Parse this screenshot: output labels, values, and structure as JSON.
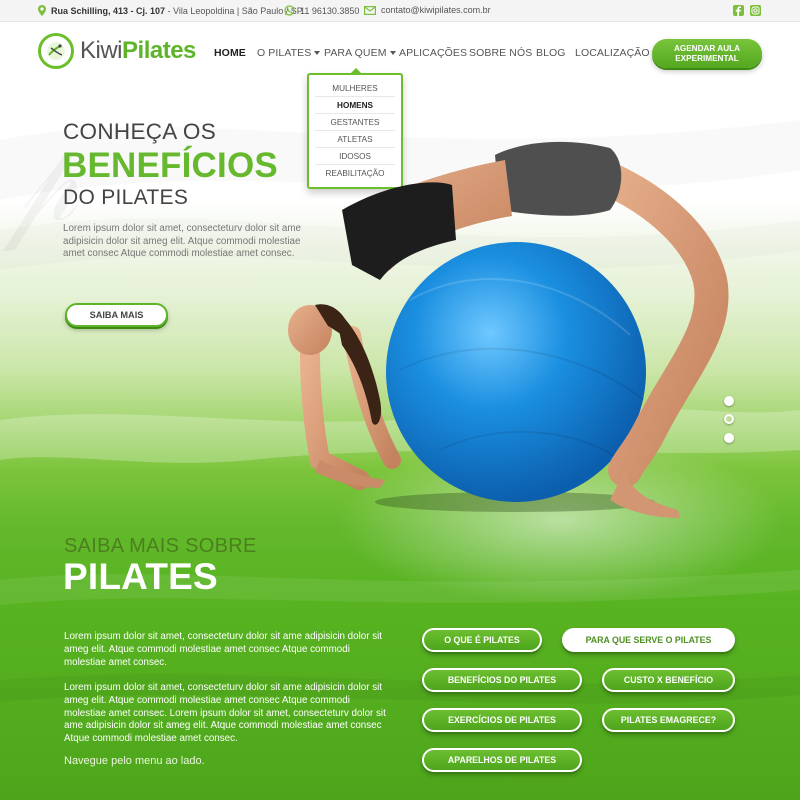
{
  "topbar": {
    "address_bold": "Rua Schilling, 413 - Cj. 107",
    "address_rest": " - Vila Leopoldina | São Paulo / SP",
    "phone": "11 96130.3850",
    "email": "contato@kiwipilates.com.br",
    "social": [
      "facebook-icon",
      "instagram-icon"
    ]
  },
  "logo": {
    "part1": "Kiwi",
    "part2": "Pilates"
  },
  "nav": {
    "items": [
      {
        "label": "HOME",
        "active": true
      },
      {
        "label": "O PILATES",
        "dropdown": true
      },
      {
        "label": "PARA QUEM",
        "dropdown": true,
        "open": true
      },
      {
        "label": "APLICAÇÕES"
      },
      {
        "label": "SOBRE NÓS"
      },
      {
        "label": "BLOG"
      },
      {
        "label": "LOCALIZAÇÃO"
      }
    ],
    "cta": "AGENDAR AULA EXPERIMENTAL"
  },
  "dropdown": {
    "items": [
      "MULHERES",
      "HOMENS",
      "GESTANTES",
      "ATLETAS",
      "IDOSOS",
      "REABILITAÇÃO"
    ],
    "current": "HOMENS"
  },
  "hero": {
    "line1": "CONHEÇA OS",
    "line2": "BENEFÍCIOS",
    "line3": "DO PILATES",
    "text": "Lorem ipsum dolor sit amet, consecteturv dolor sit ame adipisicin dolor sit ameg elit. Atque commodi molestiae amet consec Atque commodi molestiae amet consec.",
    "button": "SAIBA MAIS",
    "slides": 3,
    "active_slide": 2
  },
  "section2": {
    "line1": "SAIBA MAIS SOBRE",
    "line2": "PILATES",
    "para1": "Lorem ipsum dolor sit amet, consecteturv dolor sit ame adipisicin dolor sit ameg elit. Atque commodi molestiae amet consec Atque commodi molestiae amet consec.",
    "para2": "Lorem ipsum dolor sit amet, consecteturv dolor sit ame adipisicin dolor sit ameg elit. Atque commodi molestiae amet consec Atque commodi molestiae amet consec. Lorem ipsum dolor sit amet, consecteturv dolor sit ame adipisicin dolor sit ameg elit. Atque commodi molestiae amet consec Atque commodi molestiae amet consec.",
    "navegue": "Navegue pelo menu ao lado.",
    "links": [
      {
        "label": "O QUE É PILATES",
        "style": "green"
      },
      {
        "label": "PARA QUE SERVE O PILATES",
        "style": "white"
      },
      {
        "label": "BENEFÍCIOS DO PILATES",
        "style": "green"
      },
      {
        "label": "CUSTO X BENEFÍCIO",
        "style": "green"
      },
      {
        "label": "EXERCÍCIOS DE PILATES",
        "style": "green"
      },
      {
        "label": "PILATES EMAGRECE?",
        "style": "green"
      },
      {
        "label": "APARELHOS DE PILATES",
        "style": "green"
      }
    ]
  },
  "colors": {
    "brand_green": "#5fb52a",
    "dark_green": "#3d8a12",
    "text_gray": "#444444"
  }
}
